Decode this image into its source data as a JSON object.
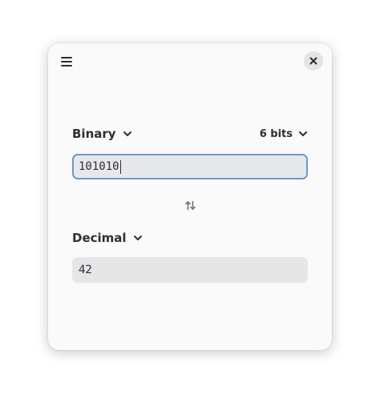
{
  "window": {
    "menu_icon": "hamburger-menu-icon",
    "close_icon": "close-icon"
  },
  "input": {
    "type_label": "Binary",
    "bits_label": "6 bits",
    "value": "101010"
  },
  "swap_icon": "swap-vertical-arrows-icon",
  "output": {
    "type_label": "Decimal",
    "value": "42"
  },
  "colors": {
    "focus_border": "#6f98c9",
    "field_background": "#e6e6e8",
    "window_background": "#fafafb",
    "text": "#2e2e33"
  }
}
